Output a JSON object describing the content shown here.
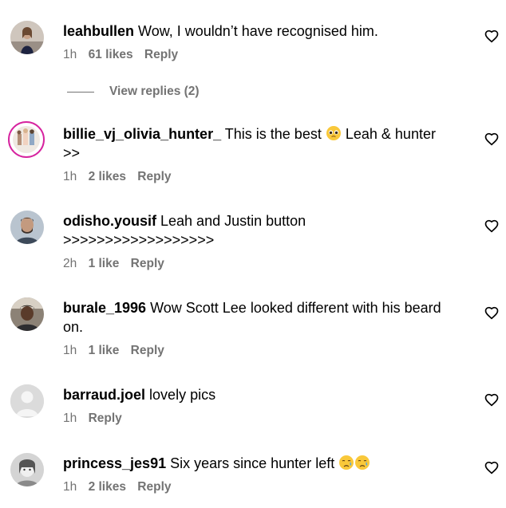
{
  "comments": [
    {
      "username": "leahbullen",
      "text": "Wow, I wouldn’t have recognised him.",
      "time": "1h",
      "likes": "61 likes",
      "reply": "Reply",
      "avatar": "profile-photo-leahbullen",
      "view_replies": "View replies (2)"
    },
    {
      "username": "billie_vj_olivia_hunter_",
      "text_before_emoji": "This is the best",
      "emoji": "pleading-face-emoji",
      "text_after_emoji": "Leah & hunter",
      "text_line2": ">>",
      "time": "1h",
      "likes": "2 likes",
      "reply": "Reply",
      "avatar": "profile-photo-billie"
    },
    {
      "username": "odisho.yousif",
      "text": "Leah and Justin button",
      "text_line2": ">>>>>>>>>>>>>>>>>>",
      "time": "2h",
      "likes": "1 like",
      "reply": "Reply",
      "avatar": "profile-photo-odisho"
    },
    {
      "username": "burale_1996",
      "text": "Wow Scott Lee looked different with his beard",
      "text_line2": "on.",
      "time": "1h",
      "likes": "1 like",
      "reply": "Reply",
      "avatar": "profile-photo-burale"
    },
    {
      "username": "barraud.joel",
      "text": "lovely pics",
      "time": "1h",
      "reply": "Reply",
      "avatar": "default-avatar"
    },
    {
      "username": "princess_jes91",
      "text": "Six years since hunter left",
      "emoji": "crying-face-emoji x2",
      "time": "1h",
      "likes": "2 likes",
      "reply": "Reply",
      "avatar": "profile-photo-princess"
    }
  ],
  "icons": {
    "heart": "heart-outline-icon"
  },
  "colors": {
    "text": "#000000",
    "meta": "#737373",
    "background": "#ffffff"
  }
}
